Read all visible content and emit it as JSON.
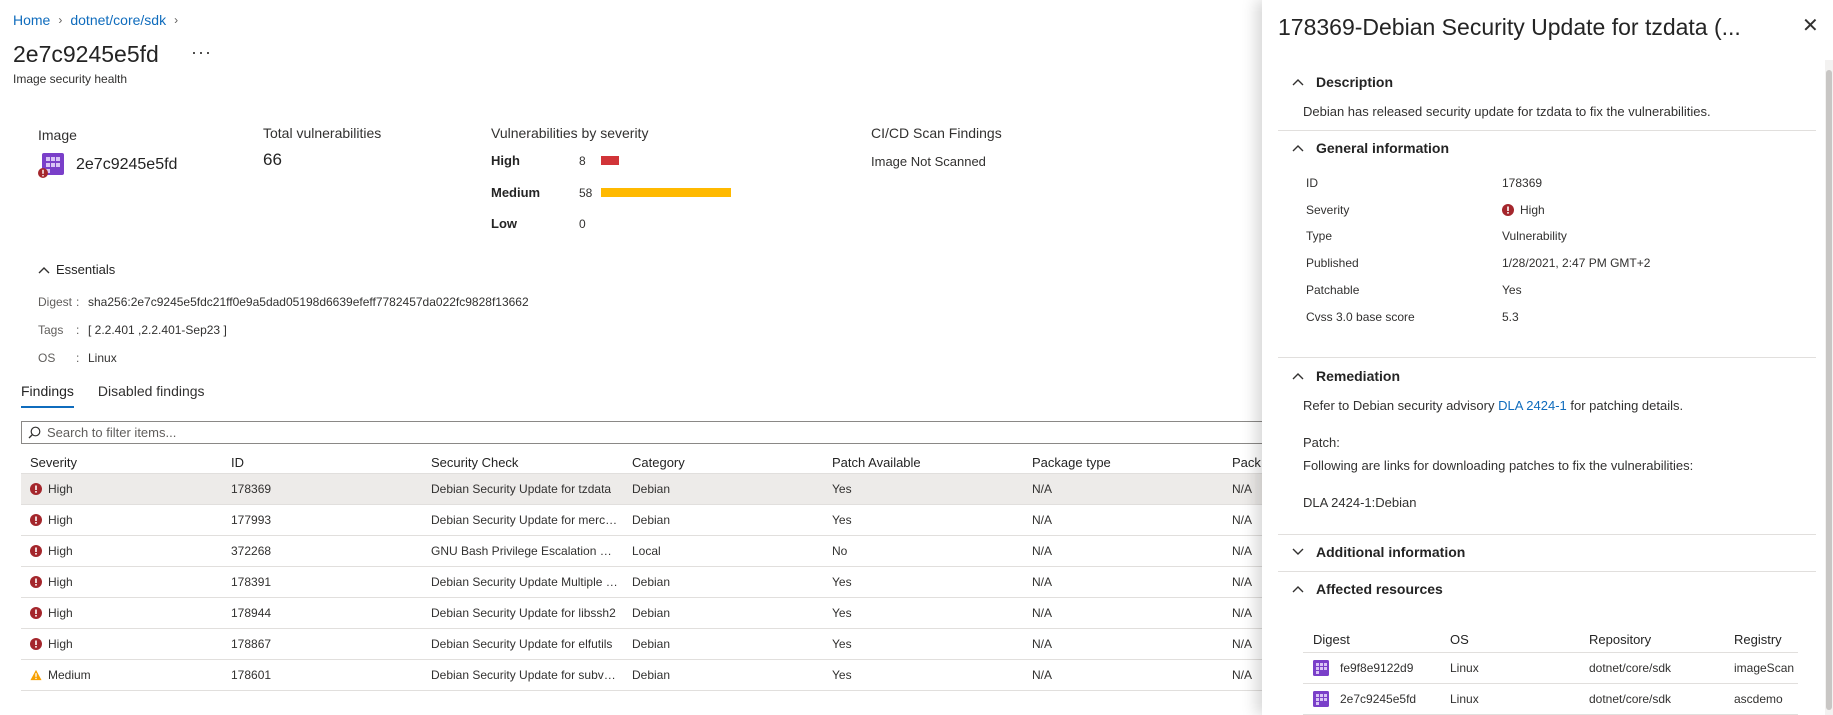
{
  "breadcrumb": {
    "home": "Home",
    "repo": "dotnet/core/sdk"
  },
  "header": {
    "title": "2e7c9245e5fd",
    "more": "···",
    "subtitle": "Image security health"
  },
  "summary": {
    "image_label": "Image",
    "image_name": "2e7c9245e5fd",
    "total_label": "Total vulnerabilities",
    "total_value": "66",
    "by_severity_label": "Vulnerabilities by severity",
    "severities": [
      {
        "name": "High",
        "count": "8",
        "color": "#d13438",
        "fraction": 0.069
      },
      {
        "name": "Medium",
        "count": "58",
        "color": "#ffb900",
        "fraction": 0.5
      },
      {
        "name": "Low",
        "count": "0",
        "color": "#107c10",
        "fraction": 0
      }
    ],
    "cicd_label": "CI/CD Scan Findings",
    "cicd_value": "Image Not Scanned"
  },
  "essentials": {
    "toggle": "Essentials",
    "digest_key": "Digest",
    "digest_value": "sha256:2e7c9245e5fdc21ff0e9a5dad05198d6639efeff7782457da022fc9828f13662",
    "tags_key": "Tags",
    "tags_value": "[ 2.2.401 ,2.2.401-Sep23 ]",
    "os_key": "OS",
    "os_value": "Linux",
    "colon": ":"
  },
  "tabs": [
    {
      "label": "Findings"
    },
    {
      "label": "Disabled findings"
    }
  ],
  "filter": {
    "placeholder": "Search to filter items..."
  },
  "grid": {
    "headers": {
      "severity": "Severity",
      "id": "ID",
      "check": "Security Check",
      "category": "Category",
      "patch": "Patch Available",
      "pkg_type": "Package type",
      "pack": "Pack"
    },
    "rows": [
      {
        "severity": "High",
        "id": "178369",
        "check": "Debian Security Update for tzdata",
        "category": "Debian",
        "patch": "Yes",
        "pkg_type": "N/A",
        "pack": "N/A"
      },
      {
        "severity": "High",
        "id": "177993",
        "check": "Debian Security Update for mercurial",
        "category": "Debian",
        "patch": "Yes",
        "pkg_type": "N/A",
        "pack": "N/A"
      },
      {
        "severity": "High",
        "id": "372268",
        "check": "GNU Bash Privilege Escalation Vulnerability",
        "category": "Local",
        "patch": "No",
        "pkg_type": "N/A",
        "pack": "N/A"
      },
      {
        "severity": "High",
        "id": "178391",
        "check": "Debian Security Update Multiple Packages",
        "category": "Debian",
        "patch": "Yes",
        "pkg_type": "N/A",
        "pack": "N/A"
      },
      {
        "severity": "High",
        "id": "178944",
        "check": "Debian Security Update for libssh2",
        "category": "Debian",
        "patch": "Yes",
        "pkg_type": "N/A",
        "pack": "N/A"
      },
      {
        "severity": "High",
        "id": "178867",
        "check": "Debian Security Update for elfutils",
        "category": "Debian",
        "patch": "Yes",
        "pkg_type": "N/A",
        "pack": "N/A"
      },
      {
        "severity": "Medium",
        "id": "178601",
        "check": "Debian Security Update for subversion",
        "category": "Debian",
        "patch": "Yes",
        "pkg_type": "N/A",
        "pack": "N/A"
      }
    ]
  },
  "panel": {
    "title": "178369-Debian Security Update for tzdata (...",
    "close": "✕",
    "description": {
      "head": "Description",
      "text": "Debian has released security update for tzdata to fix the vulnerabilities."
    },
    "general": {
      "head": "General information",
      "rows": [
        {
          "key": "ID",
          "value": "178369"
        },
        {
          "key": "Severity",
          "value": "High"
        },
        {
          "key": "Type",
          "value": "Vulnerability"
        },
        {
          "key": "Published",
          "value": "1/28/2021, 2:47 PM GMT+2"
        },
        {
          "key": "Patchable",
          "value": "Yes"
        },
        {
          "key": "Cvss 3.0 base score",
          "value": "5.3"
        }
      ]
    },
    "remediation": {
      "head": "Remediation",
      "text_before": "Refer to Debian security advisory ",
      "advisory_link": "DLA 2424-1",
      "text_after": " for patching details.",
      "patch_label": "Patch:",
      "patch_text": "Following are links for downloading patches to fix the vulnerabilities:",
      "patch_link": "DLA 2424-1:Debian"
    },
    "additional": {
      "head": "Additional information"
    },
    "affected": {
      "head": "Affected resources",
      "headers": {
        "digest": "Digest",
        "os": "OS",
        "repo": "Repository",
        "registry": "Registry"
      },
      "rows": [
        {
          "digest": "fe9f8e9122d9",
          "os": "Linux",
          "repo": "dotnet/core/sdk",
          "registry": "imageScan"
        },
        {
          "digest": "2e7c9245e5fd",
          "os": "Linux",
          "repo": "dotnet/core/sdk",
          "registry": "ascdemo"
        }
      ]
    }
  }
}
